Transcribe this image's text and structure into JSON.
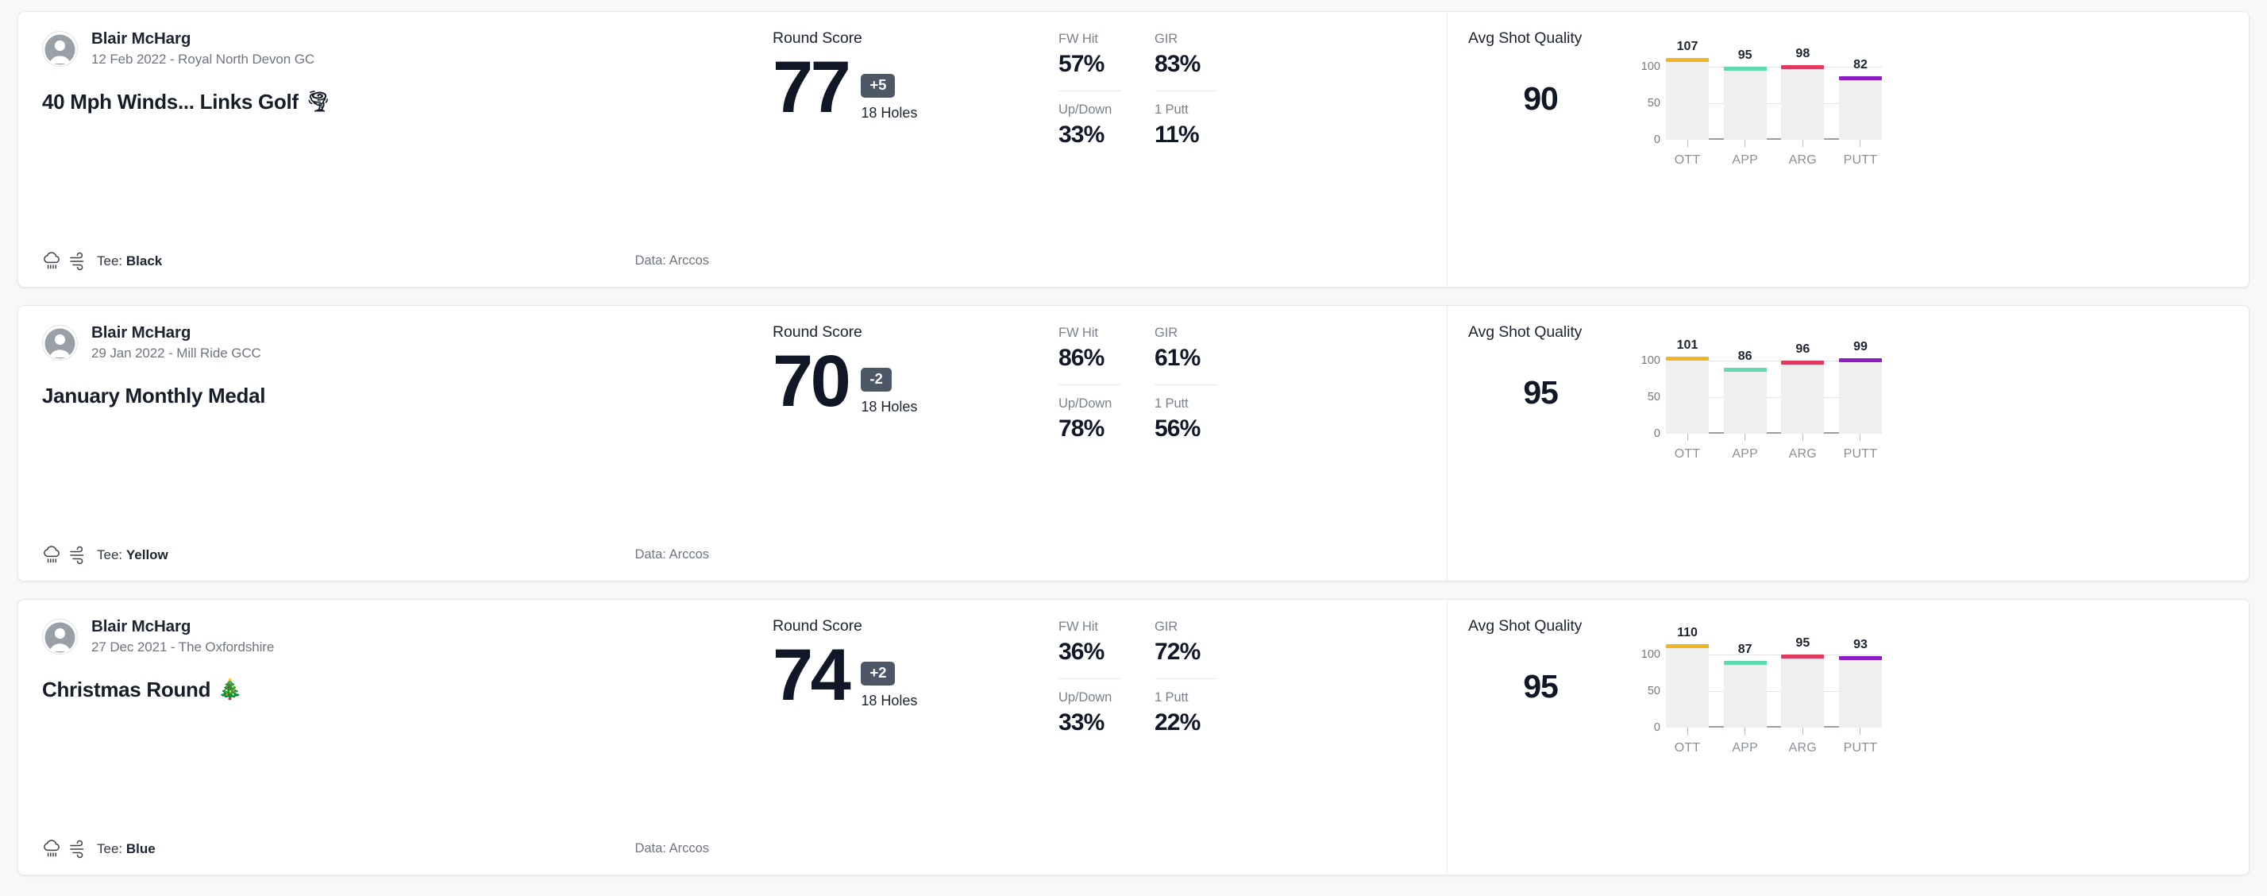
{
  "theme": {
    "page_background": "#f7f8fa",
    "card_background": "#ffffff",
    "badge_background": "#4c5866",
    "hexagon_stroke": "#3b76bf",
    "bar_background": "#efeff0",
    "series_colors": {
      "OTT": "#f0b427",
      "APP": "#5fd9b0",
      "ARG": "#e13a5e",
      "PUTT": "#8c1ec4"
    }
  },
  "labels": {
    "round_score": "Round Score",
    "holes": "18 Holes",
    "avg_shot_quality": "Avg Shot Quality",
    "tee_prefix": "Tee: ",
    "fw_hit": "FW Hit",
    "gir": "GIR",
    "up_down": "Up/Down",
    "one_putt": "1 Putt",
    "y_ticks": [
      "100",
      "50",
      "0"
    ],
    "categories": [
      "OTT",
      "APP",
      "ARG",
      "PUTT"
    ]
  },
  "rounds": [
    {
      "player_name": "Blair McHarg",
      "player_sub": "12 Feb 2022 - Royal North Devon GC",
      "title": "40 Mph Winds... Links Golf",
      "title_emoji": "🌪",
      "tee": "Black",
      "data_source": "Data: Arccos",
      "score": "77",
      "score_badge": "+5",
      "holes": "18 Holes",
      "stats": {
        "fw_hit": "57%",
        "gir": "83%",
        "up_down": "33%",
        "one_putt": "11%"
      },
      "quality": "90",
      "chart_data": {
        "type": "bar",
        "title": "Avg Shot Quality",
        "categories": [
          "OTT",
          "APP",
          "ARG",
          "PUTT"
        ],
        "values": [
          107,
          95,
          98,
          82
        ],
        "colors": [
          "#f0b427",
          "#5fd9b0",
          "#e13a5e",
          "#8c1ec4"
        ],
        "ylim": [
          0,
          115
        ],
        "yticks": [
          0,
          50,
          100
        ],
        "xlabel": "",
        "ylabel": "",
        "grid": true,
        "legend": "none"
      }
    },
    {
      "player_name": "Blair McHarg",
      "player_sub": "29 Jan 2022 - Mill Ride GCC",
      "title": "January Monthly Medal",
      "title_emoji": "",
      "tee": "Yellow",
      "data_source": "Data: Arccos",
      "score": "70",
      "score_badge": "-2",
      "holes": "18 Holes",
      "stats": {
        "fw_hit": "86%",
        "gir": "61%",
        "up_down": "78%",
        "one_putt": "56%"
      },
      "quality": "95",
      "chart_data": {
        "type": "bar",
        "title": "Avg Shot Quality",
        "categories": [
          "OTT",
          "APP",
          "ARG",
          "PUTT"
        ],
        "values": [
          101,
          86,
          96,
          99
        ],
        "colors": [
          "#f0b427",
          "#5fd9b0",
          "#e13a5e",
          "#8c1ec4"
        ],
        "ylim": [
          0,
          115
        ],
        "yticks": [
          0,
          50,
          100
        ],
        "xlabel": "",
        "ylabel": "",
        "grid": true,
        "legend": "none"
      }
    },
    {
      "player_name": "Blair McHarg",
      "player_sub": "27 Dec 2021 - The Oxfordshire",
      "title": "Christmas Round",
      "title_emoji": "🎄",
      "tee": "Blue",
      "data_source": "Data: Arccos",
      "score": "74",
      "score_badge": "+2",
      "holes": "18 Holes",
      "stats": {
        "fw_hit": "36%",
        "gir": "72%",
        "up_down": "33%",
        "one_putt": "22%"
      },
      "quality": "95",
      "chart_data": {
        "type": "bar",
        "title": "Avg Shot Quality",
        "categories": [
          "OTT",
          "APP",
          "ARG",
          "PUTT"
        ],
        "values": [
          110,
          87,
          95,
          93
        ],
        "colors": [
          "#f0b427",
          "#5fd9b0",
          "#e13a5e",
          "#8c1ec4"
        ],
        "ylim": [
          0,
          115
        ],
        "yticks": [
          0,
          50,
          100
        ],
        "xlabel": "",
        "ylabel": "",
        "grid": true,
        "legend": "none"
      }
    }
  ]
}
